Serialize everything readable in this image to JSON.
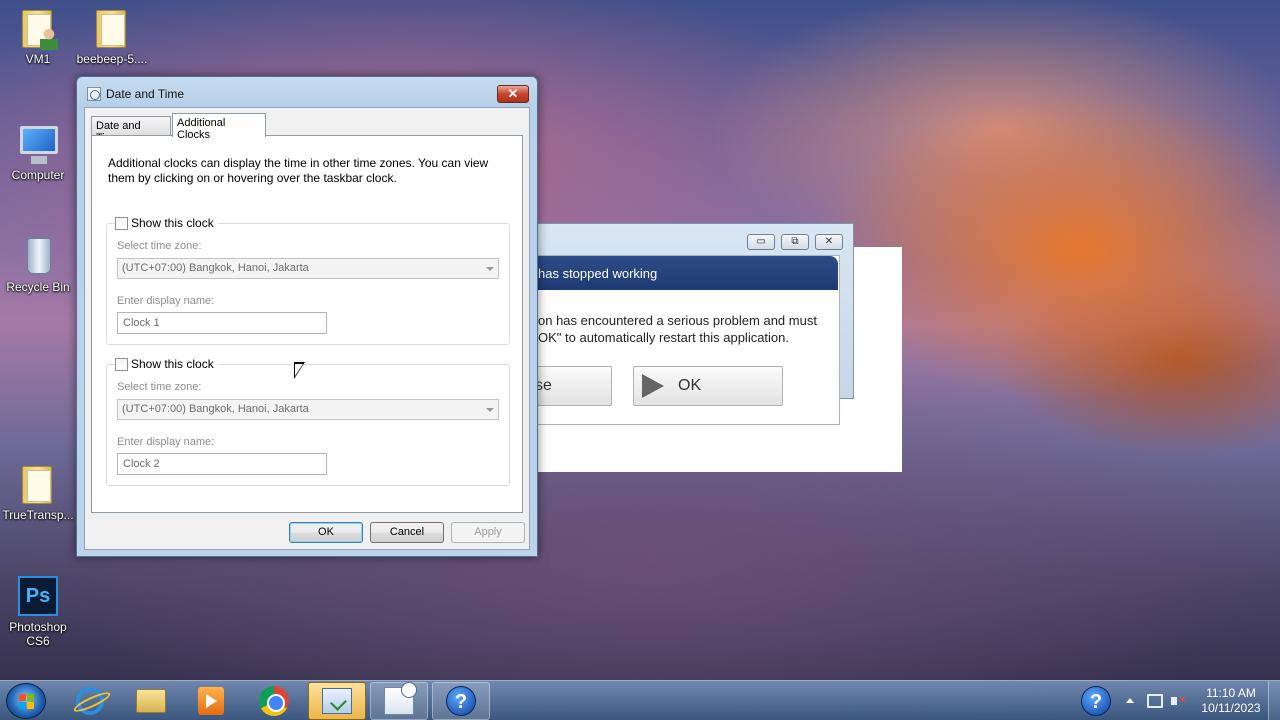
{
  "desktop_icons": [
    {
      "label": "VM1",
      "icon": "folder-user-icon"
    },
    {
      "label": "beebeep-5....",
      "icon": "folder-icon"
    },
    {
      "label": "Computer",
      "icon": "computer-icon"
    },
    {
      "label": "Recycle Bin",
      "icon": "recycle-bin-icon"
    },
    {
      "label": "TrueTransp...",
      "icon": "folder-icon"
    },
    {
      "label": "Photoshop CS6",
      "icon": "photoshop-icon",
      "glyph": "Ps"
    }
  ],
  "error_window": {
    "title": "has stopped working",
    "message_line1": "on has encountered a serious problem and must",
    "message_line2": "OK\" to automatically restart this application.",
    "close_button": "se",
    "ok_button": "OK",
    "controls": {
      "minimize": "▭",
      "restore": "⧉",
      "close": "✕"
    }
  },
  "dialog": {
    "title": "Date and Time",
    "close_glyph": "✕",
    "tabs": [
      {
        "label": "Date and Time",
        "active": false
      },
      {
        "label": "Additional Clocks",
        "active": true
      }
    ],
    "description": "Additional clocks can display the time in other time zones. You can view them by clicking on or hovering over the taskbar clock.",
    "clocks": [
      {
        "show_label": "Show this clock",
        "checked": false,
        "timezone_label": "Select time zone:",
        "timezone_value": "(UTC+07:00) Bangkok, Hanoi, Jakarta",
        "name_label": "Enter display name:",
        "name_value": "Clock 1"
      },
      {
        "show_label": "Show this clock",
        "checked": false,
        "timezone_label": "Select time zone:",
        "timezone_value": "(UTC+07:00) Bangkok, Hanoi, Jakarta",
        "name_label": "Enter display name:",
        "name_value": "Clock 2"
      }
    ],
    "buttons": {
      "ok": "OK",
      "cancel": "Cancel",
      "apply": "Apply"
    }
  },
  "taskbar": {
    "items": [
      {
        "name": "internet-explorer-icon",
        "state": "normal"
      },
      {
        "name": "file-explorer-icon",
        "state": "normal"
      },
      {
        "name": "media-player-icon",
        "state": "normal"
      },
      {
        "name": "chrome-icon",
        "state": "normal"
      },
      {
        "name": "clock-app-icon",
        "state": "active"
      },
      {
        "name": "date-time-app-icon",
        "state": "open"
      },
      {
        "name": "help-icon",
        "state": "open"
      }
    ],
    "help_glyph": "?",
    "tray": {
      "time": "11:10 AM",
      "date": "10/11/2023"
    }
  }
}
